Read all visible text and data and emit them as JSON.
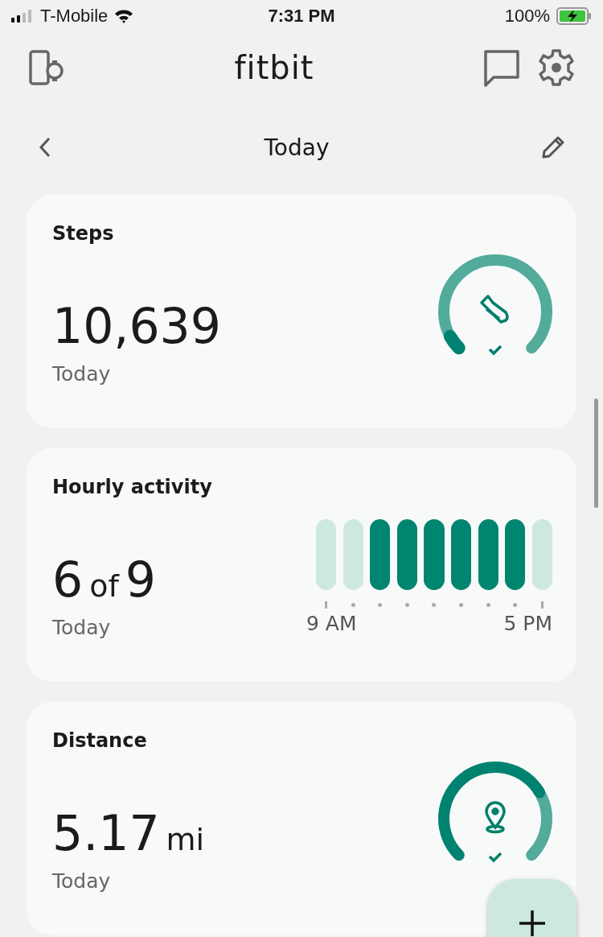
{
  "status_bar": {
    "carrier": "T-Mobile",
    "time": "7:31 PM",
    "battery": "100%"
  },
  "header": {
    "logo": "fitbit"
  },
  "date_nav": {
    "title": "Today"
  },
  "cards": [
    {
      "kind": "ring",
      "title": "Steps",
      "value": "10,639",
      "caption": "Today",
      "overflow": true
    },
    {
      "kind": "bars",
      "title": "Hourly activity",
      "value": "6",
      "joiner": "of",
      "total": "9",
      "caption": "Today",
      "bars": [
        {
          "active": false
        },
        {
          "active": false
        },
        {
          "active": true
        },
        {
          "active": true
        },
        {
          "active": true
        },
        {
          "active": true
        },
        {
          "active": true
        },
        {
          "active": true
        },
        {
          "active": false
        }
      ],
      "axis_start": "9 AM",
      "axis_end": "5 PM"
    },
    {
      "kind": "ring",
      "title": "Distance",
      "value": "5.17",
      "unit": "mi",
      "caption": "Today",
      "overflow": false
    }
  ]
}
